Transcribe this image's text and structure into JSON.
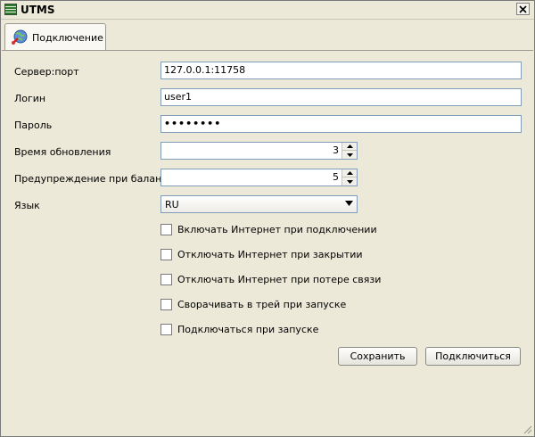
{
  "window": {
    "title": "UTMS"
  },
  "tabs": [
    {
      "label": "Подключение",
      "icon": "globe-icon"
    }
  ],
  "form": {
    "server": {
      "label": "Сервер:порт",
      "value": "127.0.0.1:11758"
    },
    "login": {
      "label": "Логин",
      "value": "user1"
    },
    "password": {
      "label": "Пароль",
      "value": "••••••••"
    },
    "refresh": {
      "label": "Время обновления",
      "value": "3"
    },
    "warning": {
      "label": "Предупреждение при балансе",
      "value": "5"
    },
    "language": {
      "label": "Язык",
      "value": "RU"
    }
  },
  "checkboxes": [
    {
      "label": "Включать Интернет при подключении",
      "checked": false
    },
    {
      "label": "Отключать Интернет при закрытии",
      "checked": false
    },
    {
      "label": "Отключать Интернет при потере связи",
      "checked": false
    },
    {
      "label": "Сворачивать в трей при запуске",
      "checked": false
    },
    {
      "label": "Подключаться при запуске",
      "checked": false
    }
  ],
  "buttons": {
    "save": "Сохранить",
    "connect": "Подключиться"
  }
}
